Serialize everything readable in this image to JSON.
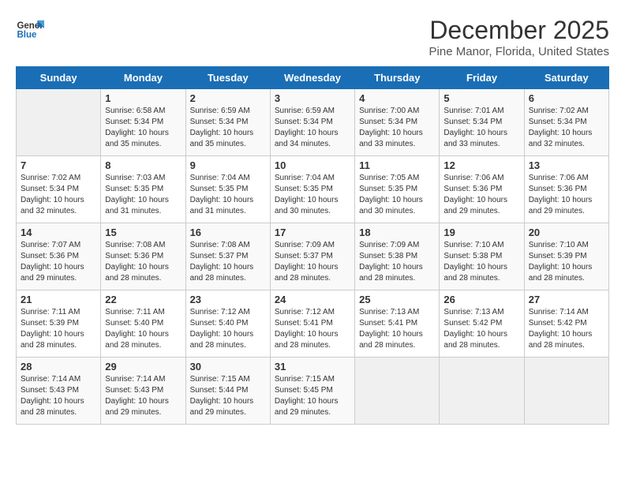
{
  "header": {
    "logo_line1": "General",
    "logo_line2": "Blue",
    "month": "December 2025",
    "location": "Pine Manor, Florida, United States"
  },
  "weekdays": [
    "Sunday",
    "Monday",
    "Tuesday",
    "Wednesday",
    "Thursday",
    "Friday",
    "Saturday"
  ],
  "weeks": [
    [
      {
        "day": "",
        "empty": true
      },
      {
        "day": "1",
        "sunrise": "6:58 AM",
        "sunset": "5:34 PM",
        "daylight": "10 hours and 35 minutes."
      },
      {
        "day": "2",
        "sunrise": "6:59 AM",
        "sunset": "5:34 PM",
        "daylight": "10 hours and 35 minutes."
      },
      {
        "day": "3",
        "sunrise": "6:59 AM",
        "sunset": "5:34 PM",
        "daylight": "10 hours and 34 minutes."
      },
      {
        "day": "4",
        "sunrise": "7:00 AM",
        "sunset": "5:34 PM",
        "daylight": "10 hours and 33 minutes."
      },
      {
        "day": "5",
        "sunrise": "7:01 AM",
        "sunset": "5:34 PM",
        "daylight": "10 hours and 33 minutes."
      },
      {
        "day": "6",
        "sunrise": "7:02 AM",
        "sunset": "5:34 PM",
        "daylight": "10 hours and 32 minutes."
      }
    ],
    [
      {
        "day": "7",
        "sunrise": "7:02 AM",
        "sunset": "5:34 PM",
        "daylight": "10 hours and 32 minutes."
      },
      {
        "day": "8",
        "sunrise": "7:03 AM",
        "sunset": "5:35 PM",
        "daylight": "10 hours and 31 minutes."
      },
      {
        "day": "9",
        "sunrise": "7:04 AM",
        "sunset": "5:35 PM",
        "daylight": "10 hours and 31 minutes."
      },
      {
        "day": "10",
        "sunrise": "7:04 AM",
        "sunset": "5:35 PM",
        "daylight": "10 hours and 30 minutes."
      },
      {
        "day": "11",
        "sunrise": "7:05 AM",
        "sunset": "5:35 PM",
        "daylight": "10 hours and 30 minutes."
      },
      {
        "day": "12",
        "sunrise": "7:06 AM",
        "sunset": "5:36 PM",
        "daylight": "10 hours and 29 minutes."
      },
      {
        "day": "13",
        "sunrise": "7:06 AM",
        "sunset": "5:36 PM",
        "daylight": "10 hours and 29 minutes."
      }
    ],
    [
      {
        "day": "14",
        "sunrise": "7:07 AM",
        "sunset": "5:36 PM",
        "daylight": "10 hours and 29 minutes."
      },
      {
        "day": "15",
        "sunrise": "7:08 AM",
        "sunset": "5:36 PM",
        "daylight": "10 hours and 28 minutes."
      },
      {
        "day": "16",
        "sunrise": "7:08 AM",
        "sunset": "5:37 PM",
        "daylight": "10 hours and 28 minutes."
      },
      {
        "day": "17",
        "sunrise": "7:09 AM",
        "sunset": "5:37 PM",
        "daylight": "10 hours and 28 minutes."
      },
      {
        "day": "18",
        "sunrise": "7:09 AM",
        "sunset": "5:38 PM",
        "daylight": "10 hours and 28 minutes."
      },
      {
        "day": "19",
        "sunrise": "7:10 AM",
        "sunset": "5:38 PM",
        "daylight": "10 hours and 28 minutes."
      },
      {
        "day": "20",
        "sunrise": "7:10 AM",
        "sunset": "5:39 PM",
        "daylight": "10 hours and 28 minutes."
      }
    ],
    [
      {
        "day": "21",
        "sunrise": "7:11 AM",
        "sunset": "5:39 PM",
        "daylight": "10 hours and 28 minutes."
      },
      {
        "day": "22",
        "sunrise": "7:11 AM",
        "sunset": "5:40 PM",
        "daylight": "10 hours and 28 minutes."
      },
      {
        "day": "23",
        "sunrise": "7:12 AM",
        "sunset": "5:40 PM",
        "daylight": "10 hours and 28 minutes."
      },
      {
        "day": "24",
        "sunrise": "7:12 AM",
        "sunset": "5:41 PM",
        "daylight": "10 hours and 28 minutes."
      },
      {
        "day": "25",
        "sunrise": "7:13 AM",
        "sunset": "5:41 PM",
        "daylight": "10 hours and 28 minutes."
      },
      {
        "day": "26",
        "sunrise": "7:13 AM",
        "sunset": "5:42 PM",
        "daylight": "10 hours and 28 minutes."
      },
      {
        "day": "27",
        "sunrise": "7:14 AM",
        "sunset": "5:42 PM",
        "daylight": "10 hours and 28 minutes."
      }
    ],
    [
      {
        "day": "28",
        "sunrise": "7:14 AM",
        "sunset": "5:43 PM",
        "daylight": "10 hours and 28 minutes."
      },
      {
        "day": "29",
        "sunrise": "7:14 AM",
        "sunset": "5:43 PM",
        "daylight": "10 hours and 29 minutes."
      },
      {
        "day": "30",
        "sunrise": "7:15 AM",
        "sunset": "5:44 PM",
        "daylight": "10 hours and 29 minutes."
      },
      {
        "day": "31",
        "sunrise": "7:15 AM",
        "sunset": "5:45 PM",
        "daylight": "10 hours and 29 minutes."
      },
      {
        "day": "",
        "empty": true
      },
      {
        "day": "",
        "empty": true
      },
      {
        "day": "",
        "empty": true
      }
    ]
  ]
}
